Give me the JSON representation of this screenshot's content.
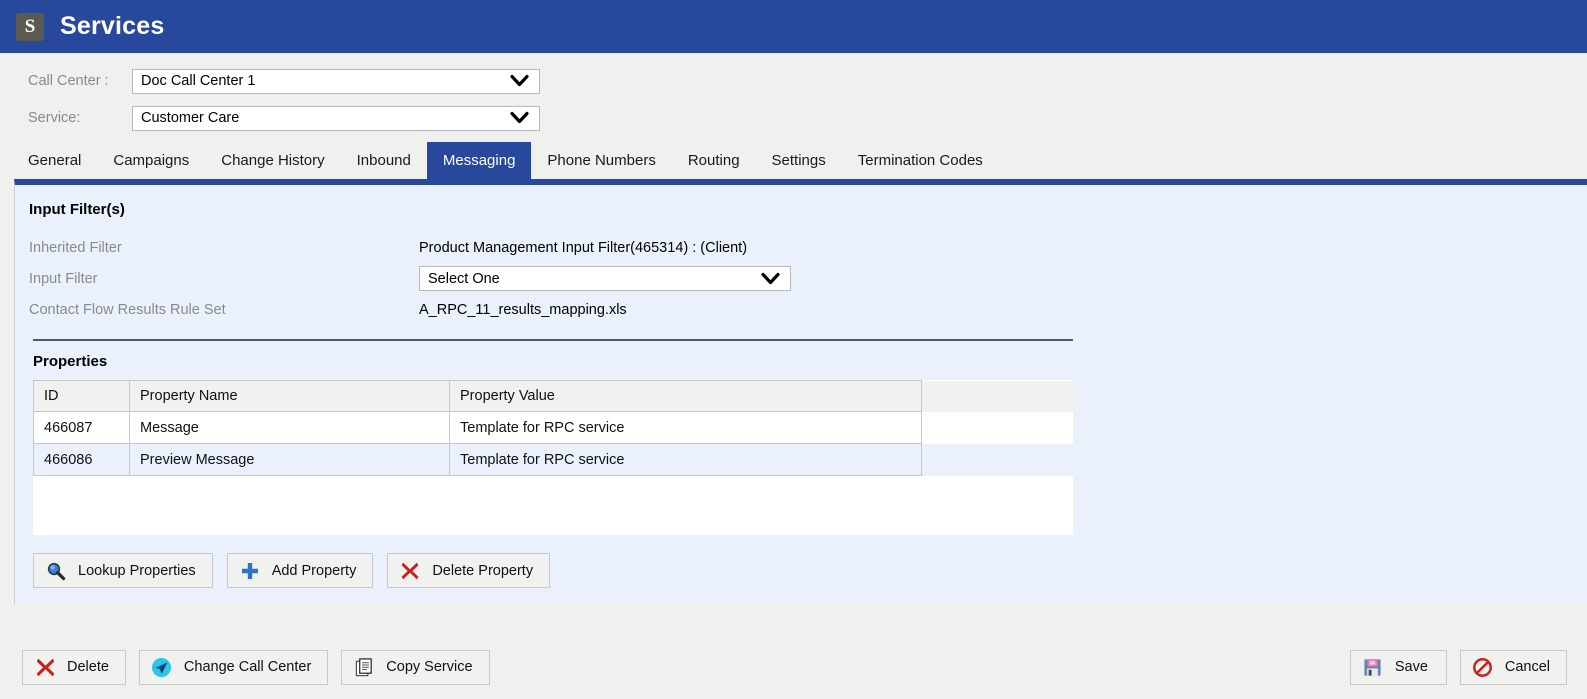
{
  "titlebar": {
    "icon_letter": "S",
    "icon_name": "services-app-icon",
    "title": "Services"
  },
  "selectors": [
    {
      "label": "Call Center :",
      "value": "Doc Call Center 1",
      "name": "call-center"
    },
    {
      "label": "Service:",
      "value": "Customer Care",
      "name": "service"
    }
  ],
  "tabs": [
    {
      "label": "General",
      "active": false
    },
    {
      "label": "Campaigns",
      "active": false
    },
    {
      "label": "Change History",
      "active": false
    },
    {
      "label": "Inbound",
      "active": false
    },
    {
      "label": "Messaging",
      "active": true
    },
    {
      "label": "Phone Numbers",
      "active": false
    },
    {
      "label": "Routing",
      "active": false
    },
    {
      "label": "Settings",
      "active": false
    },
    {
      "label": "Termination Codes",
      "active": false
    }
  ],
  "input_filters": {
    "section_title": "Input Filter(s)",
    "inherited_filter_label": "Inherited Filter",
    "inherited_filter_value": "Product Management Input Filter(465314) : (Client)",
    "input_filter_label": "Input Filter",
    "input_filter_value": "Select One",
    "rule_set_label": "Contact Flow Results Rule Set",
    "rule_set_value": "A_RPC_11_results_mapping.xls"
  },
  "properties": {
    "section_title": "Properties",
    "columns": [
      "ID",
      "Property Name",
      "Property Value"
    ],
    "rows": [
      {
        "id": "466087",
        "name": "Message",
        "value": "Template for RPC service"
      },
      {
        "id": "466086",
        "name": "Preview Message",
        "value": "Template for RPC service"
      }
    ],
    "buttons": [
      {
        "label": "Lookup Properties",
        "icon": "magnifier-icon"
      },
      {
        "label": "Add Property",
        "icon": "plus-icon"
      },
      {
        "label": "Delete Property",
        "icon": "red-x-icon"
      }
    ]
  },
  "bottom_toolbar": {
    "left": [
      {
        "label": "Delete",
        "icon": "red-x-icon"
      },
      {
        "label": "Change Call Center",
        "icon": "paper-plane-icon"
      },
      {
        "label": "Copy Service",
        "icon": "document-copy-icon"
      }
    ],
    "right": [
      {
        "label": "Save",
        "icon": "floppy-disk-icon"
      },
      {
        "label": "Cancel",
        "icon": "no-entry-icon"
      }
    ]
  },
  "colors": {
    "brand_blue": "#28489b",
    "panel_bg": "#eaf1fd",
    "page_bg": "#f0f0ef",
    "row_alt": "#eaf1fd",
    "danger_red": "#c62222",
    "accent_teal": "#2ec6e6"
  }
}
